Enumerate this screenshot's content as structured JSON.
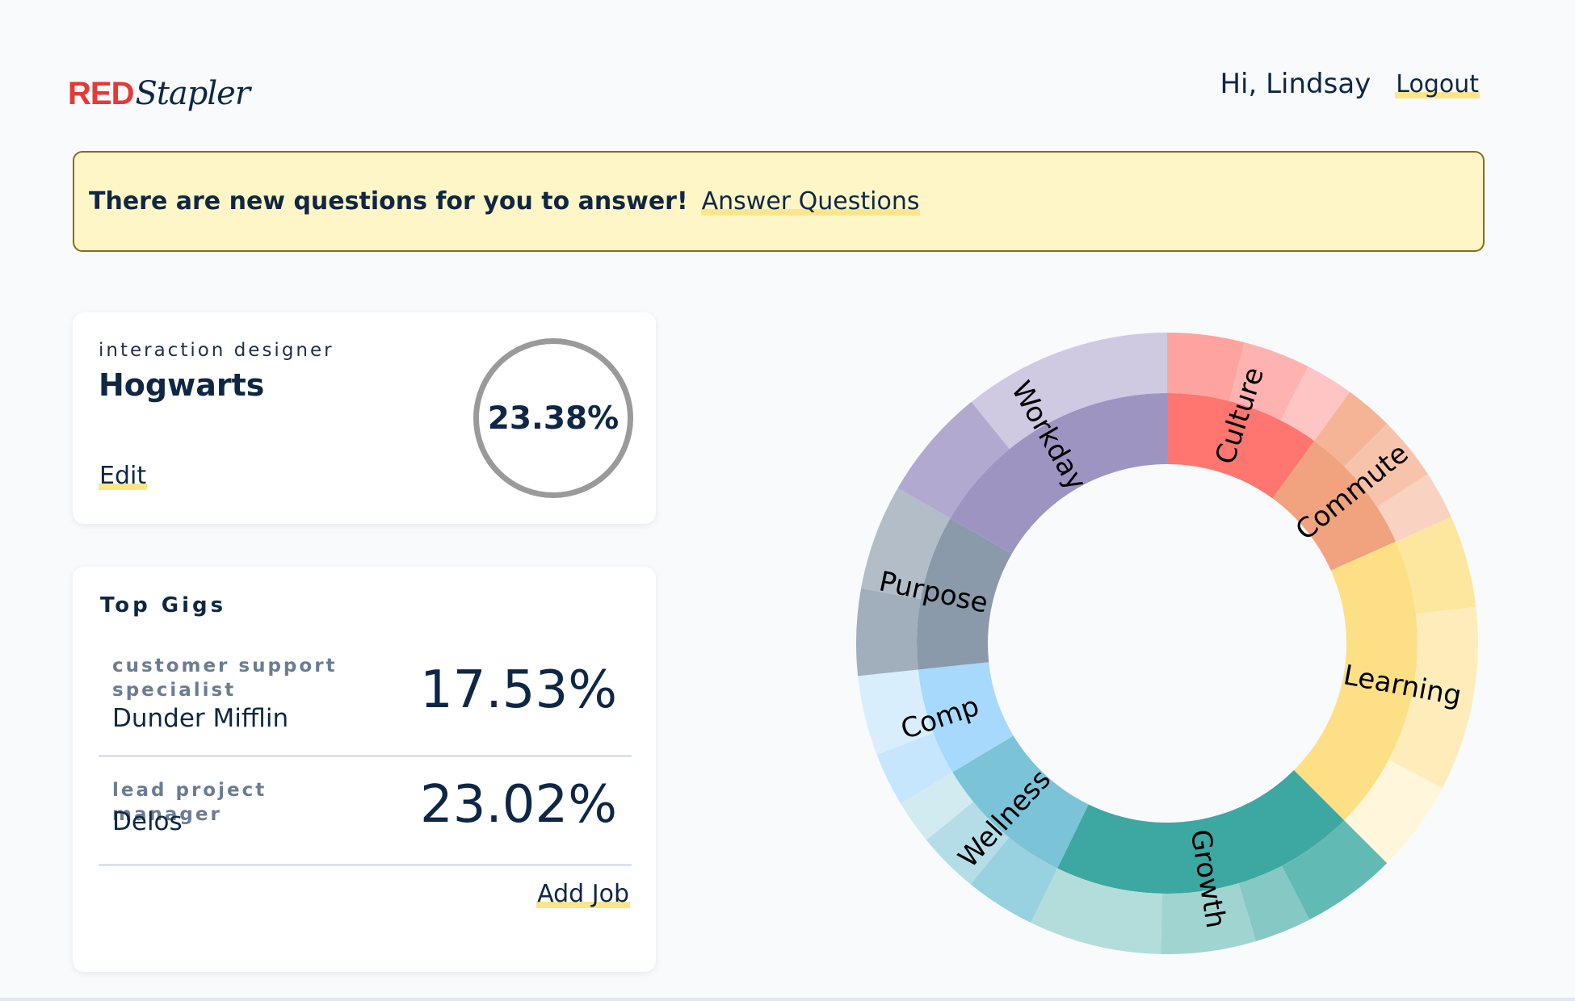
{
  "header": {
    "logo_red": "RED",
    "logo_script": "Stapler",
    "greeting": "Hi, Lindsay",
    "logout_label": "Logout"
  },
  "banner": {
    "message": "There are new questions for you to answer!",
    "link_label": "Answer Questions"
  },
  "profile": {
    "role": "interaction designer",
    "company": "Hogwarts",
    "edit_label": "Edit",
    "score": "23.38%"
  },
  "top_gigs": {
    "title": "Top Gigs",
    "items": [
      {
        "role": "customer support specialist",
        "company": "Dunder Mifflin",
        "score": "17.53%"
      },
      {
        "role": "lead project manager",
        "company": "Delos",
        "score": "23.02%"
      }
    ],
    "add_label": "Add Job"
  },
  "colors": {
    "brand_red": "#e53935",
    "text_navy": "#0f2744",
    "banner_bg": "#fef6c6",
    "highlight": "#fde68a"
  },
  "chart_data": {
    "type": "sunburst",
    "categories": [
      {
        "name": "Culture",
        "share": 0.1,
        "inner_color": "#ff7570",
        "outer": [
          {
            "share": 0.4,
            "color": "#ffa3a0"
          },
          {
            "share": 0.35,
            "color": "#ffb3b1"
          },
          {
            "share": 0.25,
            "color": "#ffc5c4"
          }
        ]
      },
      {
        "name": "Commute",
        "share": 0.0833,
        "inner_color": "#f1a27e",
        "outer": [
          {
            "share": 0.3,
            "color": "#f4b495"
          },
          {
            "share": 0.4,
            "color": "#f7c4ab"
          },
          {
            "share": 0.3,
            "color": "#f9d2c1"
          }
        ]
      },
      {
        "name": "Learning",
        "share": 0.1917,
        "inner_color": "#fde086",
        "outer": [
          {
            "share": 0.25,
            "color": "#fde69d"
          },
          {
            "share": 0.5,
            "color": "#feedbb"
          },
          {
            "share": 0.25,
            "color": "#fff6db"
          }
        ]
      },
      {
        "name": "Growth",
        "share": 0.1972,
        "inner_color": "#3da7a1",
        "outer": [
          {
            "share": 0.25,
            "color": "#62bab5"
          },
          {
            "share": 0.15,
            "color": "#85c8c4"
          },
          {
            "share": 0.25,
            "color": "#a0d4d1"
          },
          {
            "share": 0.35,
            "color": "#b2ddda"
          }
        ]
      },
      {
        "name": "Wellness",
        "share": 0.0917,
        "inner_color": "#7bc3d6",
        "outer": [
          {
            "share": 0.4,
            "color": "#98d2e1"
          },
          {
            "share": 0.35,
            "color": "#b5dde8"
          },
          {
            "share": 0.25,
            "color": "#d2ebf1"
          }
        ]
      },
      {
        "name": "Comp",
        "share": 0.0694,
        "inner_color": "#a6d9fb",
        "outer": [
          {
            "share": 0.4,
            "color": "#c5e6fd"
          },
          {
            "share": 0.6,
            "color": "#d9eefd"
          }
        ]
      },
      {
        "name": "Purpose",
        "share": 0.1,
        "inner_color": "#8a9aab",
        "outer": [
          {
            "share": 0.45,
            "color": "#a1aebb"
          },
          {
            "share": 0.55,
            "color": "#b3bdc8"
          }
        ]
      },
      {
        "name": "Workday",
        "share": 0.1667,
        "inner_color": "#9e94c2",
        "outer": [
          {
            "share": 0.35,
            "color": "#b1a9cf"
          },
          {
            "share": 0.65,
            "color": "#cfc9e2"
          }
        ]
      }
    ]
  }
}
